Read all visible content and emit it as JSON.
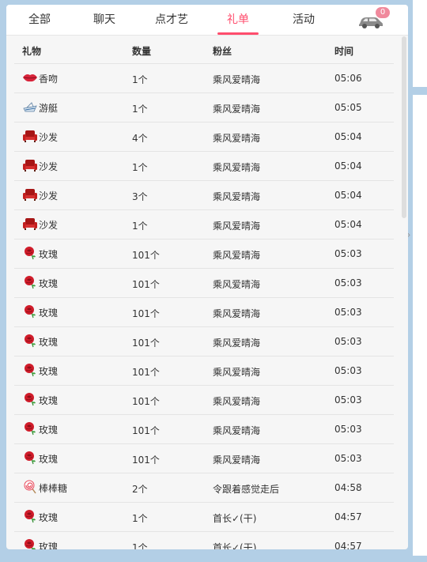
{
  "tabs": [
    {
      "label": "全部",
      "active": false
    },
    {
      "label": "聊天",
      "active": false
    },
    {
      "label": "点才艺",
      "active": false
    },
    {
      "label": "礼单",
      "active": true
    },
    {
      "label": "活动",
      "active": false
    }
  ],
  "car_badge": "0",
  "columns": [
    "礼物",
    "数量",
    "粉丝",
    "时间"
  ],
  "rows": [
    {
      "icon": "lips-icon",
      "gift": "香吻",
      "qty": "1个",
      "fan": "乘风爱晴海",
      "time": "05:06"
    },
    {
      "icon": "yacht-icon",
      "gift": "游艇",
      "qty": "1个",
      "fan": "乘风爱晴海",
      "time": "05:05"
    },
    {
      "icon": "sofa-icon",
      "gift": "沙发",
      "qty": "4个",
      "fan": "乘风爱晴海",
      "time": "05:04"
    },
    {
      "icon": "sofa-icon",
      "gift": "沙发",
      "qty": "1个",
      "fan": "乘风爱晴海",
      "time": "05:04"
    },
    {
      "icon": "sofa-icon",
      "gift": "沙发",
      "qty": "3个",
      "fan": "乘风爱晴海",
      "time": "05:04"
    },
    {
      "icon": "sofa-icon",
      "gift": "沙发",
      "qty": "1个",
      "fan": "乘风爱晴海",
      "time": "05:04"
    },
    {
      "icon": "rose-icon",
      "gift": "玫瑰",
      "qty": "101个",
      "fan": "乘风爱晴海",
      "time": "05:03"
    },
    {
      "icon": "rose-icon",
      "gift": "玫瑰",
      "qty": "101个",
      "fan": "乘风爱晴海",
      "time": "05:03"
    },
    {
      "icon": "rose-icon",
      "gift": "玫瑰",
      "qty": "101个",
      "fan": "乘风爱晴海",
      "time": "05:03"
    },
    {
      "icon": "rose-icon",
      "gift": "玫瑰",
      "qty": "101个",
      "fan": "乘风爱晴海",
      "time": "05:03"
    },
    {
      "icon": "rose-icon",
      "gift": "玫瑰",
      "qty": "101个",
      "fan": "乘风爱晴海",
      "time": "05:03"
    },
    {
      "icon": "rose-icon",
      "gift": "玫瑰",
      "qty": "101个",
      "fan": "乘风爱晴海",
      "time": "05:03"
    },
    {
      "icon": "rose-icon",
      "gift": "玫瑰",
      "qty": "101个",
      "fan": "乘风爱晴海",
      "time": "05:03"
    },
    {
      "icon": "rose-icon",
      "gift": "玫瑰",
      "qty": "101个",
      "fan": "乘风爱晴海",
      "time": "05:03"
    },
    {
      "icon": "lollipop-icon",
      "gift": "棒棒糖",
      "qty": "2个",
      "fan": "令跟着感觉走后",
      "time": "04:58"
    },
    {
      "icon": "rose-icon",
      "gift": "玫瑰",
      "qty": "1个",
      "fan": "首长✓(干)",
      "time": "04:57"
    },
    {
      "icon": "rose-icon",
      "gift": "玫瑰",
      "qty": "1个",
      "fan": "首长✓(干)",
      "time": "04:57"
    }
  ],
  "colors": {
    "accent": "#ff4d6d",
    "badge": "#f0899c",
    "background": "#b3cfe6"
  }
}
